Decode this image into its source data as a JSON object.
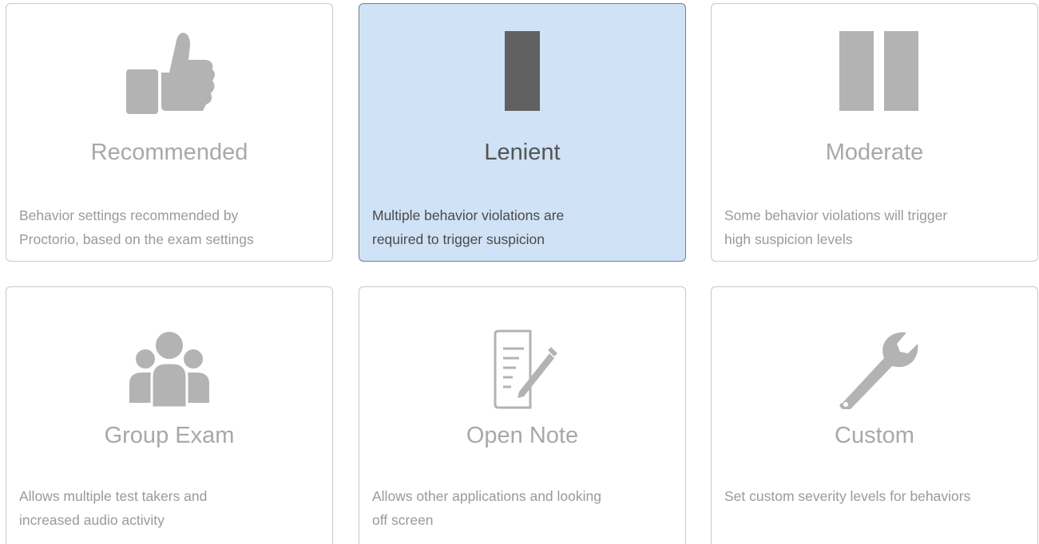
{
  "options": [
    {
      "title": "Recommended",
      "description_line1": "Behavior settings recommended by",
      "description_line2": "Proctorio, based on the exam settings",
      "icon": "thumbs-up-icon",
      "selected": false
    },
    {
      "title": "Lenient",
      "description_line1": "Multiple behavior violations are",
      "description_line2": "required to trigger suspicion",
      "icon": "single-bar-icon",
      "selected": true
    },
    {
      "title": "Moderate",
      "description_line1": "Some behavior violations will trigger",
      "description_line2": "high suspicion levels",
      "icon": "double-bar-icon",
      "selected": false
    },
    {
      "title": "Group Exam",
      "description_line1": "Allows multiple test takers and",
      "description_line2": "increased audio activity",
      "icon": "group-icon",
      "selected": false
    },
    {
      "title": "Open Note",
      "description_line1": "Allows other applications and looking",
      "description_line2": "off screen",
      "icon": "note-pencil-icon",
      "selected": false
    },
    {
      "title": "Custom",
      "description_line1": "Set custom severity levels for behaviors",
      "description_line2": "",
      "icon": "wrench-icon",
      "selected": false
    }
  ],
  "colors": {
    "icon_inactive": "#b3b3b3",
    "icon_active": "#616161",
    "selected_background": "#cfe2f6",
    "selected_border": "#6f7f92",
    "card_border": "#c8c8c8"
  }
}
